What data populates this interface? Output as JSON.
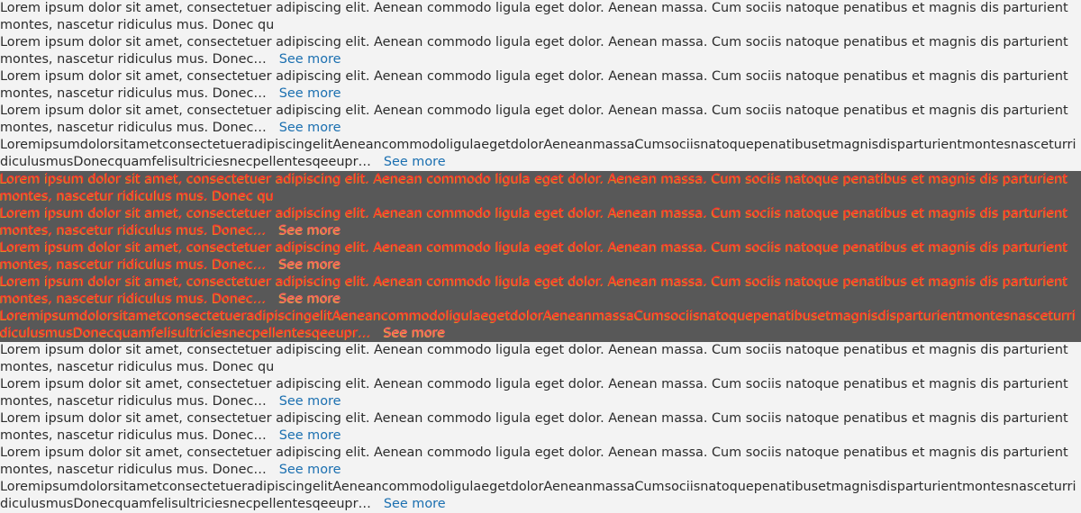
{
  "items": [
    {
      "text": "Lorem ipsum dolor sit amet, consectetuer adipiscing elit. Aenean commodo ligula eget dolor. Aenean massa. Cum sociis natoque penatibus et magnis dis parturient montes, nascetur ridiculus mus. Donec qu",
      "more": ""
    },
    {
      "text": "Lorem ipsum dolor sit amet, consectetuer adipiscing elit. Aenean commodo ligula eget dolor. Aenean massa. Cum sociis natoque penatibus et magnis dis parturient montes, nascetur ridiculus mus. Donec…",
      "more": "See more"
    },
    {
      "text": "Lorem ipsum dolor sit amet, consectetuer adipiscing elit. Aenean commodo ligula eget dolor. Aenean massa. Cum sociis natoque penatibus et magnis dis parturient montes, nascetur ridiculus mus. Donec…",
      "more": "See more"
    },
    {
      "text": "Lorem ipsum dolor sit amet, consectetuer adipiscing elit. Aenean commodo ligula eget dolor. Aenean massa. Cum sociis natoque penatibus et magnis dis parturient montes, nascetur ridiculus mus. Donec…",
      "more": "See more"
    },
    {
      "text": "LoremipsumdolorsitametconsectetueradipiscingelitAeneancommodoligulaegetdolorAeneanmassaCumsociisnatoquepenatibusetmagnisdisparturientmontesnasceturridiculusmusDonecquamfelisultriciesnecpellentesqeeupr…",
      "more": "See more"
    }
  ],
  "colors": {
    "background": "#f3f3f3",
    "text": "#2b2b2b",
    "link": "#1a6fb0",
    "overlay_band": "#585858",
    "overlay_red": "#ff2d2d",
    "overlay_orange": "#d98a28"
  }
}
